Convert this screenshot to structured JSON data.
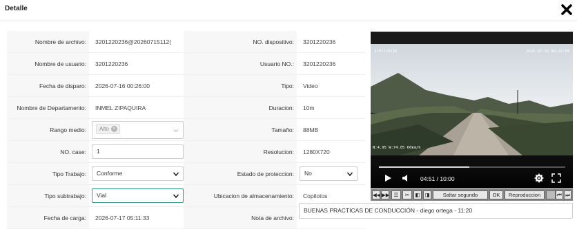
{
  "dialog": {
    "title": "Detalle"
  },
  "left": [
    {
      "label": "Nombre de archivo:",
      "value": "3201220236@20260715112("
    },
    {
      "label": "Nombre de usuario:",
      "value": "3201220236"
    },
    {
      "label": "Fecha de disparo:",
      "value": "2026-07-16 00:26:00"
    },
    {
      "label": "Nombre de Departamento:",
      "value": "INMEL ZIPAQUIRA"
    },
    {
      "label": "Rango medio:",
      "tag": "Alto"
    },
    {
      "label": "NO. case:",
      "value": "1"
    },
    {
      "label": "Tipo Trabajo:",
      "value": "Conforme"
    },
    {
      "label": "Tipo subtrabajo:",
      "value": "Vial"
    },
    {
      "label": "Fecha de carga:",
      "value": "2026-07-17 05:11:33"
    }
  ],
  "right": [
    {
      "label": "NO. dispositivo:",
      "value": "3201220236"
    },
    {
      "label": "Usuario NO.:",
      "value": "3201220236"
    },
    {
      "label": "Tipo:",
      "value": "Video"
    },
    {
      "label": "Duracion:",
      "value": "10m"
    },
    {
      "label": "Tamaño:",
      "value": "88MB"
    },
    {
      "label": "Resolucion:",
      "value": "1280X720"
    },
    {
      "label": "Estado de proteccion:",
      "value": "No"
    },
    {
      "label": "Ubicacion de almacenamiento:",
      "value": "Copilotos"
    },
    {
      "label": "Nota de archivo:",
      "value": "BUENAS PRACTICAS DE CONDUCCIÓN - diego ortega - 11:20"
    }
  ],
  "video": {
    "time": "04:51 / 10:00",
    "progress": 0.485,
    "osd_left": "3201220236",
    "osd_right": "2026-07-16 00:26:00",
    "osd_bottom": "N:4.95 W:74.05 60km/h"
  },
  "toolbar": {
    "skip_label": "Saltar segundo",
    "ok_label": "OK",
    "playback_label": "Reproduccion"
  }
}
